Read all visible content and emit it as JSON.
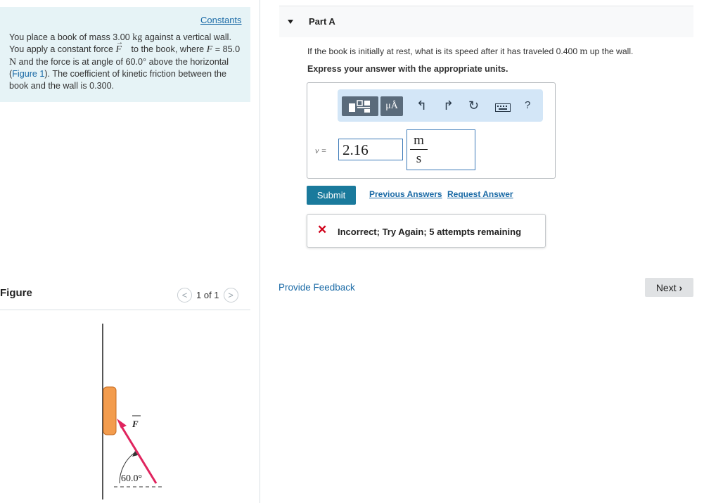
{
  "problem": {
    "constants_link": "Constants",
    "sentence1_a": "You place a book of mass 3.00 ",
    "unit_kg": "kg",
    "sentence1_b": " against a vertical wall. You apply a constant force ",
    "force_symbol": "F",
    "sentence1_c": " to the book, where ",
    "force_var": "F",
    "sentence1_d": " = 85.0 ",
    "unit_N": "N",
    "sentence1_e": " and the force is at angle of 60.0° above the horizontal (",
    "figure_ref": "Figure 1",
    "sentence1_f": "). The coefficient of kinetic friction between the book and the wall is 0.300."
  },
  "figure": {
    "heading": "Figure",
    "pager_text": "1 of 1",
    "force_label": "F",
    "angle_label": "60.0°",
    "colors": {
      "book": "#f39c4d",
      "force_arrow": "#e0245e"
    }
  },
  "part": {
    "label": "Part A",
    "question_a": "If the book is initially at rest, what is its speed after it has traveled 0.400 ",
    "question_unit": "m",
    "question_b": " up the wall.",
    "instruction": "Express your answer with the appropriate units."
  },
  "toolbar": {
    "unit_button": "μÅ",
    "help": "?"
  },
  "answer": {
    "var_label": "v =",
    "value": "2.16",
    "unit_numerator": "m",
    "unit_denominator": "s"
  },
  "actions": {
    "submit": "Submit",
    "previous_answers": "Previous Answers",
    "request_answer": "Request Answer"
  },
  "feedback": {
    "status": "Incorrect; Try Again; 5 attempts remaining",
    "status_color": "#d0021b"
  },
  "footer": {
    "provide_feedback": "Provide Feedback",
    "next": "Next"
  }
}
